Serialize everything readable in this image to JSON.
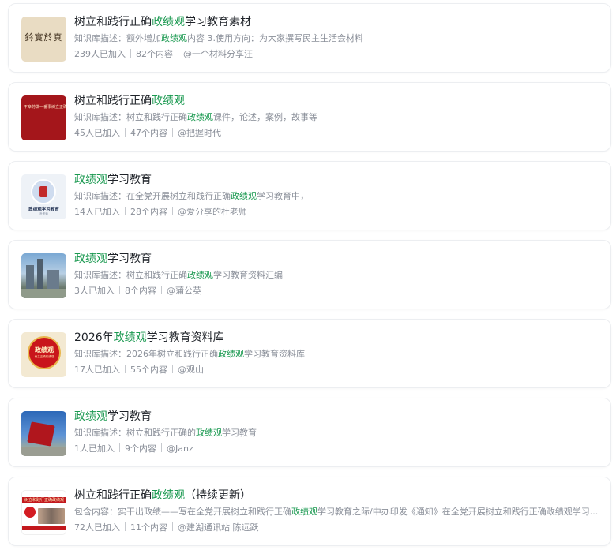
{
  "items": [
    {
      "title_pre": "树立和践行正确",
      "title_hl": "政绩观",
      "title_post": "学习教育素材",
      "desc_pre": "知识库描述：额外增加",
      "desc_hl": "政绩观",
      "desc_post": "内容 3.使用方向：为大家撰写民主生活会材料",
      "members": "239人已加入",
      "contents": "82个内容",
      "author": "@一个材料分享汪",
      "thumb_text": "鈐實於真"
    },
    {
      "title_pre": "树立和践行正确",
      "title_hl": "政绩观",
      "title_post": "",
      "desc_pre": "知识库描述：树立和践行正确",
      "desc_hl": "政绩观",
      "desc_post": "课件，论述，案例，故事等",
      "members": "45人已加入",
      "contents": "47个内容",
      "author": "@把握时代",
      "thumb_text": "不辛劳做一番事树立正确政绩观"
    },
    {
      "title_pre": "",
      "title_hl": "政绩观",
      "title_post": "学习教育",
      "desc_pre": "知识库描述：在全党开展树立和践行正确",
      "desc_hl": "政绩观",
      "desc_post": "学习教育中，",
      "members": "14人已加入",
      "contents": "28个内容",
      "author": "@爱分享的杜老师",
      "thumb_text": "政绩观学习教育",
      "thumb_sub": "杜老师"
    },
    {
      "title_pre": "",
      "title_hl": "政绩观",
      "title_post": "学习教育",
      "desc_pre": "知识库描述：树立和践行正确",
      "desc_hl": "政绩观",
      "desc_post": "学习教育资料汇编",
      "members": "3人已加入",
      "contents": "8个内容",
      "author": "@蒲公英"
    },
    {
      "title_pre": "2026年",
      "title_hl": "政绩观",
      "title_post": "学习教育资料库",
      "desc_pre": "知识库描述：2026年树立和践行正确",
      "desc_hl": "政绩观",
      "desc_post": "学习教育资料库",
      "members": "17人已加入",
      "contents": "55个内容",
      "author": "@观山",
      "thumb_text": "政绩观",
      "thumb_sub": "树立正确政绩观"
    },
    {
      "title_pre": "",
      "title_hl": "政绩观",
      "title_post": "学习教育",
      "desc_pre": "知识库描述：树立和践行正确的",
      "desc_hl": "政绩观",
      "desc_post": "学习教育",
      "members": "1人已加入",
      "contents": "9个内容",
      "author": "@Janz"
    },
    {
      "title_pre": "树立和践行正确",
      "title_hl": "政绩观",
      "title_post": "（持续更新）",
      "desc_pre": "包含内容：实干出政绩——写在全党开展树立和践行正确",
      "desc_hl": "政绩观",
      "desc_post": "学习教育之际/中办印发《通知》在全党开展树立和践行正确政绩观学习...",
      "members": "72人已加入",
      "contents": "11个内容",
      "author": "@建湖通讯站 陈远跃",
      "thumb_text": "树立和践行正确政绩观"
    }
  ],
  "colors": {
    "highlight": "#1a9950",
    "title": "#1f2329",
    "meta": "#8a8f99"
  }
}
